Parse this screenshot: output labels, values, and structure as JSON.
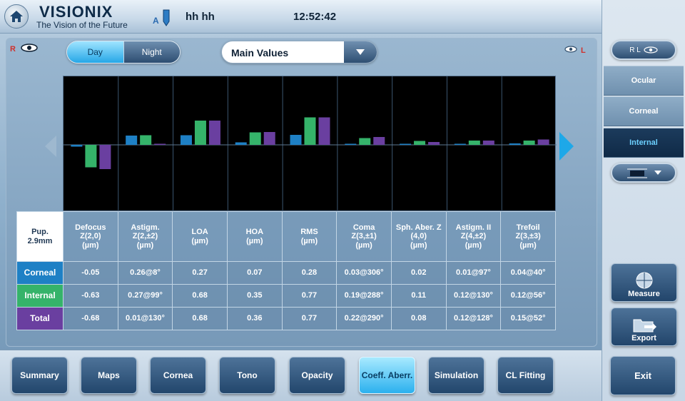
{
  "header": {
    "logo": "VISIONIX",
    "tagline": "The Vision of the Future",
    "user_letter": "A",
    "user_name": "hh hh",
    "time": "12:52:42"
  },
  "eyes": {
    "right_label": "R",
    "left_label": "L"
  },
  "toggle": {
    "day": "Day",
    "night": "Night",
    "selected": "Day"
  },
  "dropdown": {
    "value": "Main Values"
  },
  "sidebar": {
    "eye_selector": "R L",
    "tabs": [
      {
        "label": "Ocular",
        "active": false
      },
      {
        "label": "Corneal",
        "active": false
      },
      {
        "label": "Internal",
        "active": true
      }
    ],
    "measure": "Measure",
    "export": "Export"
  },
  "colors": {
    "corneal": "#1e80c5",
    "internal": "#35b36a",
    "total": "#6a3fa0",
    "active_tab": "#26a7e7"
  },
  "chart_data": {
    "type": "bar",
    "categories": [
      "Defocus",
      "Astigm.",
      "LOA",
      "HOA",
      "RMS",
      "Coma",
      "Sph. Aber. Z",
      "Astigm. II",
      "Trefoil"
    ],
    "series": [
      {
        "name": "Corneal",
        "values": [
          -0.05,
          0.26,
          0.27,
          0.07,
          0.28,
          0.03,
          0.02,
          0.01,
          0.04
        ]
      },
      {
        "name": "Internal",
        "values": [
          -0.63,
          0.27,
          0.68,
          0.35,
          0.77,
          0.19,
          0.11,
          0.12,
          0.12
        ]
      },
      {
        "name": "Total",
        "values": [
          -0.68,
          0.01,
          0.68,
          0.36,
          0.77,
          0.22,
          0.08,
          0.12,
          0.15
        ]
      }
    ],
    "ylim": [
      -1.9,
      1.9
    ]
  },
  "table": {
    "pupil": [
      "Pup.",
      "2.9mm"
    ],
    "headers": [
      [
        "Defocus",
        "Z(2,0)",
        "(µm)"
      ],
      [
        "Astigm.",
        "Z(2,±2)",
        "(µm)"
      ],
      [
        "LOA",
        "(µm)"
      ],
      [
        "HOA",
        "(µm)"
      ],
      [
        "RMS",
        "(µm)"
      ],
      [
        "Coma",
        "Z(3,±1)",
        "(µm)"
      ],
      [
        "Sph. Aber. Z",
        "(4,0)",
        "(µm)"
      ],
      [
        "Astigm. II",
        "Z(4,±2)",
        "(µm)"
      ],
      [
        "Trefoil",
        "Z(3,±3)",
        "(µm)"
      ]
    ],
    "rows": [
      {
        "label": "Corneal",
        "cells": [
          "-0.05",
          "0.26@8°",
          "0.27",
          "0.07",
          "0.28",
          "0.03@306°",
          "0.02",
          "0.01@97°",
          "0.04@40°"
        ]
      },
      {
        "label": "Internal",
        "cells": [
          "-0.63",
          "0.27@99°",
          "0.68",
          "0.35",
          "0.77",
          "0.19@288°",
          "0.11",
          "0.12@130°",
          "0.12@56°"
        ]
      },
      {
        "label": "Total",
        "cells": [
          "-0.68",
          "0.01@130°",
          "0.68",
          "0.36",
          "0.77",
          "0.22@290°",
          "0.08",
          "0.12@128°",
          "0.15@52°"
        ]
      }
    ]
  },
  "nav": {
    "buttons": [
      "Summary",
      "Maps",
      "Cornea",
      "Tono",
      "Opacity",
      "Coeff. Aberr.",
      "Simulation",
      "CL Fitting"
    ],
    "active": "Coeff. Aberr.",
    "exit": "Exit"
  }
}
